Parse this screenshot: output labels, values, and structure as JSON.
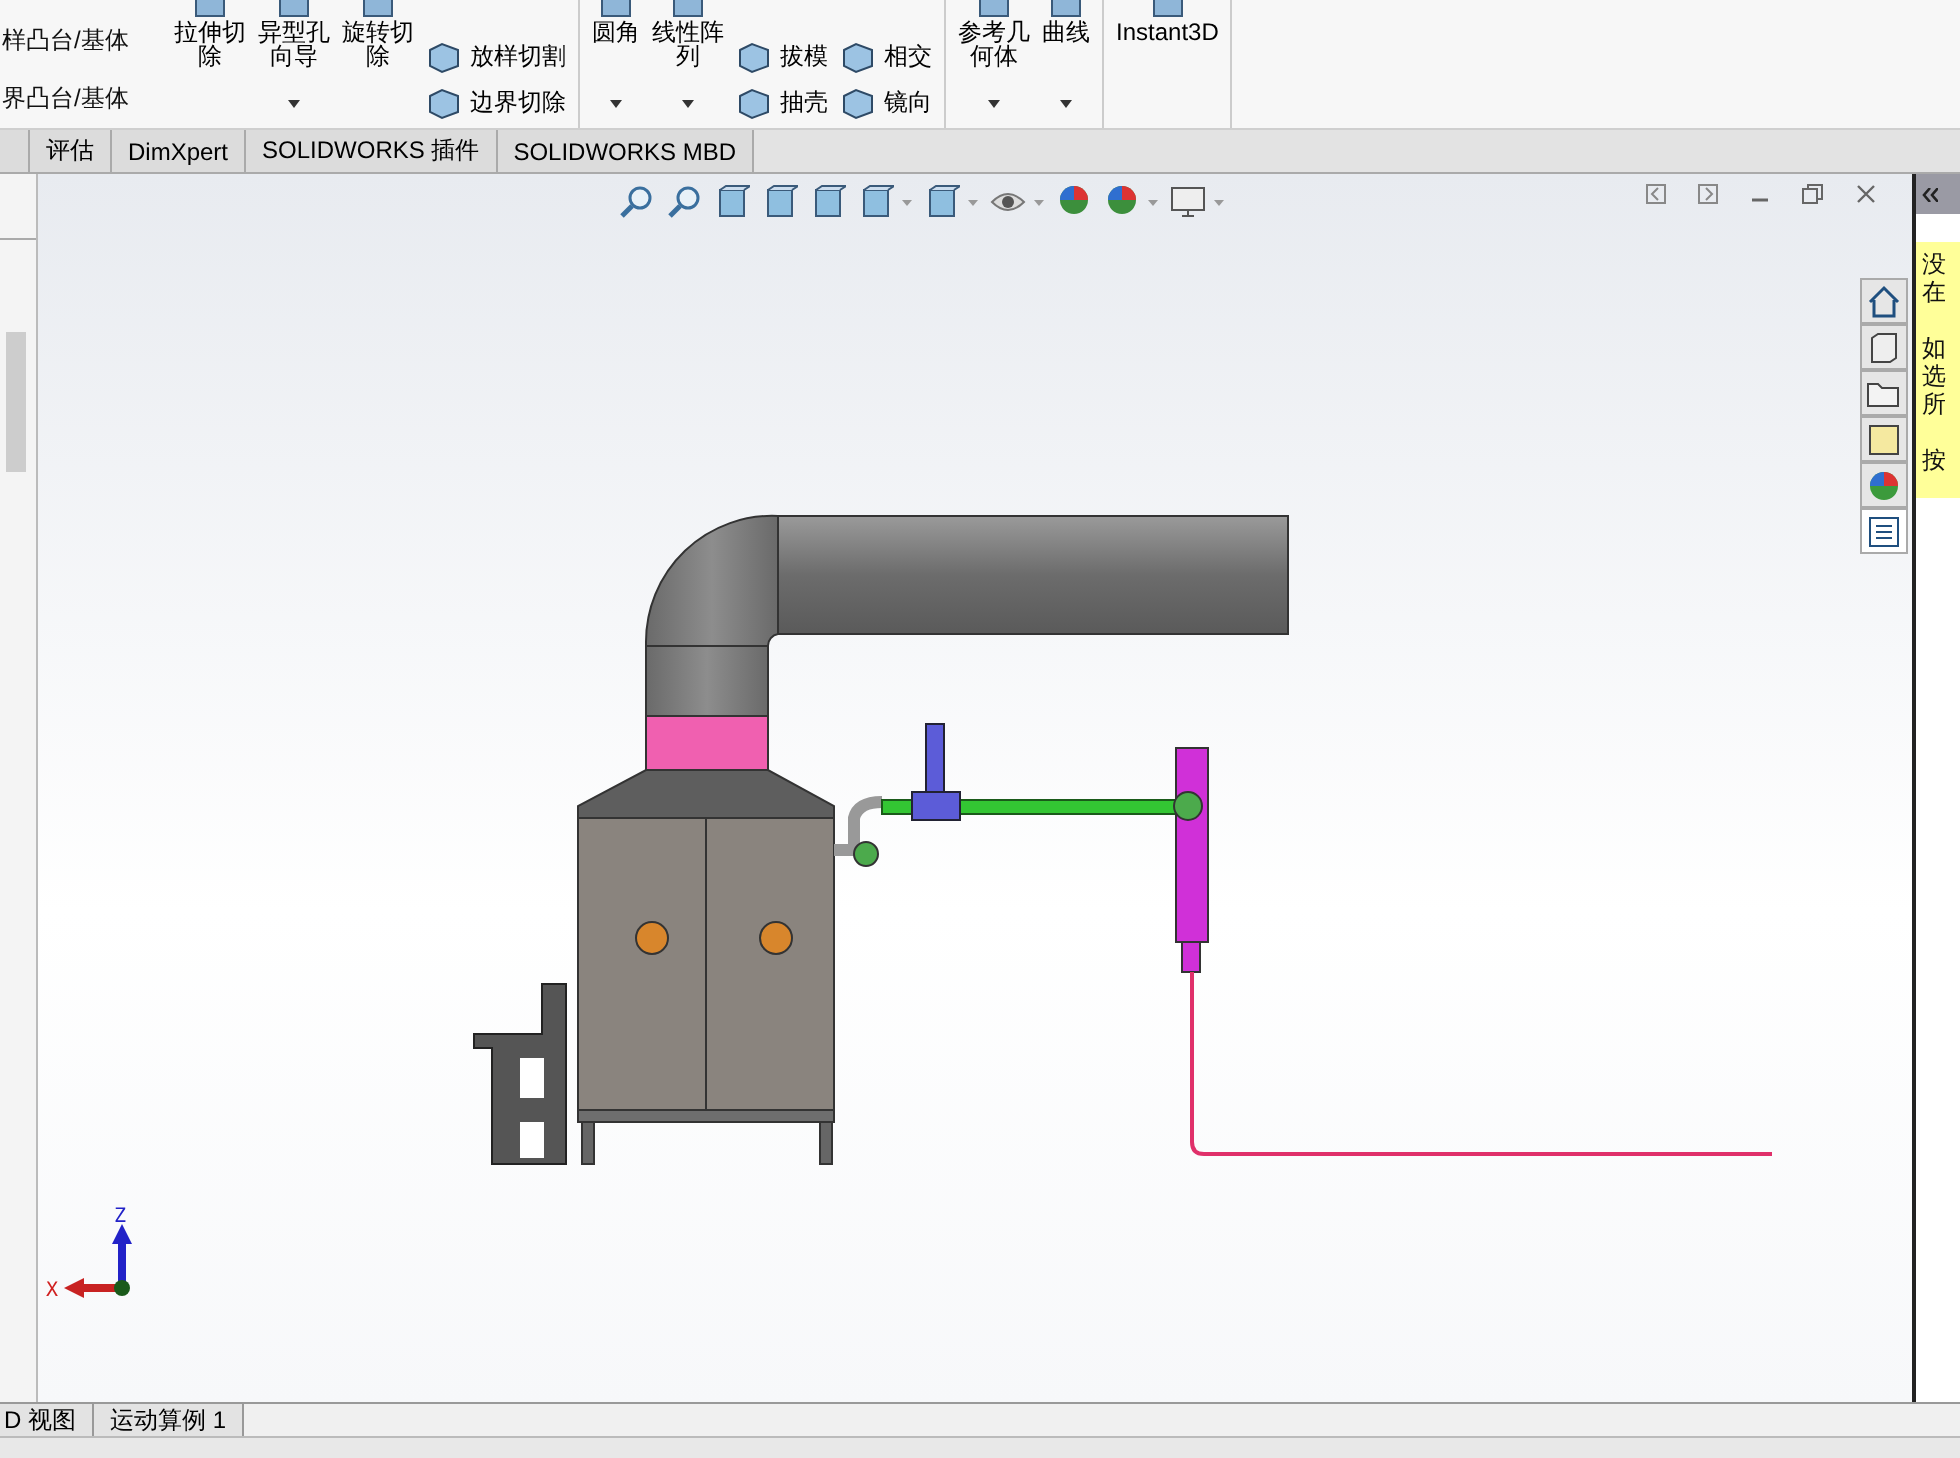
{
  "ribbon": {
    "cut_items": [
      "样凸台/基体",
      "界凸台/基体"
    ],
    "groups": [
      {
        "large": [
          {
            "lines": [
              "拉伸切",
              "除"
            ],
            "dropdown": false
          },
          {
            "lines": [
              "异型孔",
              "向导"
            ],
            "dropdown": true
          },
          {
            "lines": [
              "旋转切",
              "除"
            ],
            "dropdown": false
          }
        ],
        "small_columns": [
          [
            "放样切割",
            "边界切除"
          ]
        ]
      },
      {
        "large": [
          {
            "lines": [
              "圆角"
            ],
            "dropdown": true
          },
          {
            "lines": [
              "线性阵",
              "列"
            ],
            "dropdown": true
          }
        ],
        "small_columns": [
          [
            "拔模",
            "抽壳"
          ],
          [
            "相交",
            "镜向"
          ]
        ]
      },
      {
        "large": [
          {
            "lines": [
              "参考几",
              "何体"
            ],
            "dropdown": true
          },
          {
            "lines": [
              "曲线"
            ],
            "dropdown": true
          }
        ]
      },
      {
        "large": [
          {
            "lines": [
              "Instant3D"
            ],
            "dropdown": false
          }
        ]
      }
    ]
  },
  "command_tabs": [
    {
      "label": "评估",
      "selected": false
    },
    {
      "label": "DimXpert",
      "selected": false
    },
    {
      "label": "SOLIDWORKS 插件",
      "selected": false
    },
    {
      "label": "SOLIDWORKS MBD",
      "selected": false
    }
  ],
  "task_pane": {
    "tabs": [
      {
        "selected": false
      },
      {
        "selected": false
      },
      {
        "selected": false
      },
      {
        "selected": false
      },
      {
        "selected": false
      },
      {
        "selected": true
      }
    ],
    "note_paragraphs": [
      [
        "没",
        "在"
      ],
      [
        "如",
        "选",
        "所"
      ],
      [
        "按"
      ]
    ]
  },
  "triad": {
    "z_label": "Z",
    "x_label": "X"
  },
  "bottom_tabs": [
    {
      "label": "D 视图",
      "selected": false
    },
    {
      "label": "运动算例 1",
      "selected": false
    }
  ]
}
